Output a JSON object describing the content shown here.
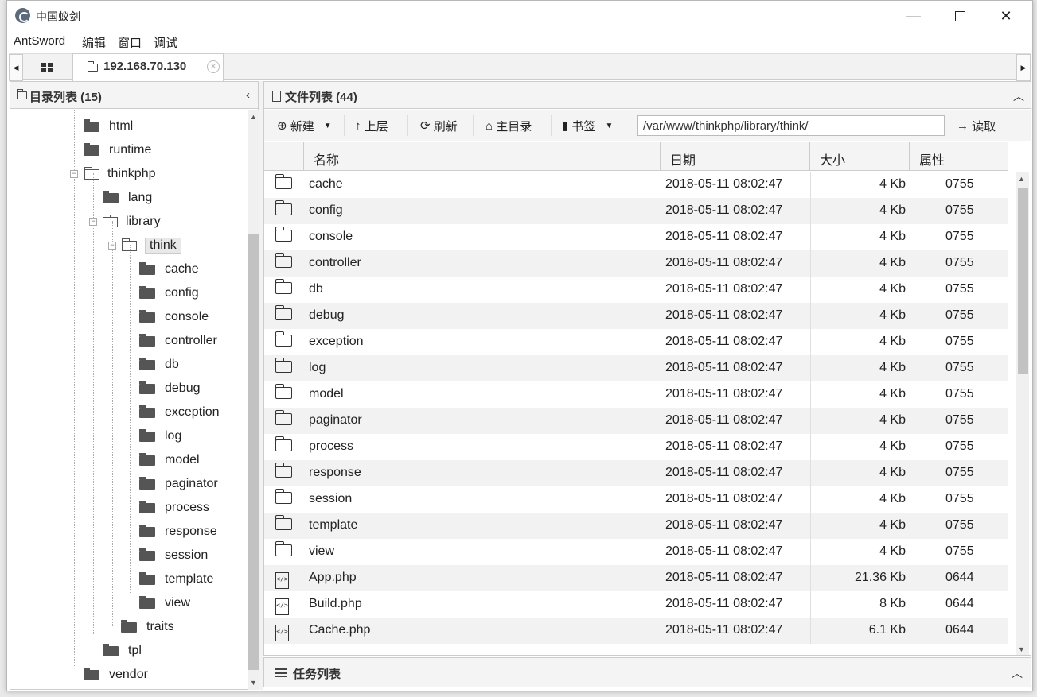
{
  "window": {
    "title": "中国蚁剑"
  },
  "menu": [
    "AntSword",
    "编辑",
    "窗口",
    "调试"
  ],
  "tab": {
    "label": "192.168.70.130"
  },
  "tree_panel": {
    "title": "目录列表 (15)",
    "nodes": [
      "html",
      "runtime",
      "thinkphp",
      "lang",
      "library",
      "think",
      "cache",
      "config",
      "console",
      "controller",
      "db",
      "debug",
      "exception",
      "log",
      "model",
      "paginator",
      "process",
      "response",
      "session",
      "template",
      "view",
      "traits",
      "tpl",
      "vendor"
    ]
  },
  "file_panel": {
    "title": "文件列表 (44)",
    "toolbar": {
      "new_label": "新建",
      "up_label": "上层",
      "refresh_label": "刷新",
      "home_label": "主目录",
      "bookmark_label": "书签",
      "path_value": "/var/www/thinkphp/library/think/",
      "read_label": "读取"
    },
    "columns": {
      "name": "名称",
      "date": "日期",
      "size": "大小",
      "attr": "属性"
    },
    "rows": [
      {
        "type": "folder",
        "name": "cache",
        "date": "2018-05-11 08:02:47",
        "size": "4 Kb",
        "attr": "0755"
      },
      {
        "type": "folder",
        "name": "config",
        "date": "2018-05-11 08:02:47",
        "size": "4 Kb",
        "attr": "0755"
      },
      {
        "type": "folder",
        "name": "console",
        "date": "2018-05-11 08:02:47",
        "size": "4 Kb",
        "attr": "0755"
      },
      {
        "type": "folder",
        "name": "controller",
        "date": "2018-05-11 08:02:47",
        "size": "4 Kb",
        "attr": "0755"
      },
      {
        "type": "folder",
        "name": "db",
        "date": "2018-05-11 08:02:47",
        "size": "4 Kb",
        "attr": "0755"
      },
      {
        "type": "folder",
        "name": "debug",
        "date": "2018-05-11 08:02:47",
        "size": "4 Kb",
        "attr": "0755"
      },
      {
        "type": "folder",
        "name": "exception",
        "date": "2018-05-11 08:02:47",
        "size": "4 Kb",
        "attr": "0755"
      },
      {
        "type": "folder",
        "name": "log",
        "date": "2018-05-11 08:02:47",
        "size": "4 Kb",
        "attr": "0755"
      },
      {
        "type": "folder",
        "name": "model",
        "date": "2018-05-11 08:02:47",
        "size": "4 Kb",
        "attr": "0755"
      },
      {
        "type": "folder",
        "name": "paginator",
        "date": "2018-05-11 08:02:47",
        "size": "4 Kb",
        "attr": "0755"
      },
      {
        "type": "folder",
        "name": "process",
        "date": "2018-05-11 08:02:47",
        "size": "4 Kb",
        "attr": "0755"
      },
      {
        "type": "folder",
        "name": "response",
        "date": "2018-05-11 08:02:47",
        "size": "4 Kb",
        "attr": "0755"
      },
      {
        "type": "folder",
        "name": "session",
        "date": "2018-05-11 08:02:47",
        "size": "4 Kb",
        "attr": "0755"
      },
      {
        "type": "folder",
        "name": "template",
        "date": "2018-05-11 08:02:47",
        "size": "4 Kb",
        "attr": "0755"
      },
      {
        "type": "folder",
        "name": "view",
        "date": "2018-05-11 08:02:47",
        "size": "4 Kb",
        "attr": "0755"
      },
      {
        "type": "php",
        "name": "App.php",
        "date": "2018-05-11 08:02:47",
        "size": "21.36 Kb",
        "attr": "0644"
      },
      {
        "type": "php",
        "name": "Build.php",
        "date": "2018-05-11 08:02:47",
        "size": "8 Kb",
        "attr": "0644"
      },
      {
        "type": "php",
        "name": "Cache.php",
        "date": "2018-05-11 08:02:47",
        "size": "6.1 Kb",
        "attr": "0644"
      }
    ]
  },
  "task_panel": {
    "title": "任务列表"
  }
}
